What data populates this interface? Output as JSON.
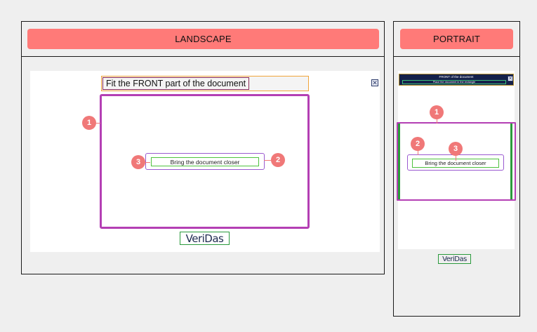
{
  "landscape": {
    "header_label": "LANDSCAPE",
    "title": "Fit the FRONT part of the document",
    "close_icon": "close-icon",
    "message": "Bring the document closer",
    "logo": "VeriDas",
    "markers": [
      "1",
      "2",
      "3"
    ]
  },
  "portrait": {
    "header_label": "PORTRAIT",
    "title": "FRONT of the document",
    "subtitle": "Place the document in the rectangle",
    "close_icon": "close-icon",
    "message": "Bring the document closer",
    "logo": "VeriDas",
    "markers": [
      "1",
      "2",
      "3"
    ]
  },
  "colors": {
    "background": "#efefef",
    "header_pill": "#ff7a78",
    "marker": "#f07878",
    "frame": "#b43fb4",
    "message_border": "#9a5ad0",
    "message_inner_border": "#4ec23e",
    "title_outer_border": "#f0a43a",
    "title_inner_border": "#8b2a55",
    "portrait_banner": "#15214a",
    "logo_text": "#1e2a50",
    "logo_border": "#2a9a3c"
  }
}
